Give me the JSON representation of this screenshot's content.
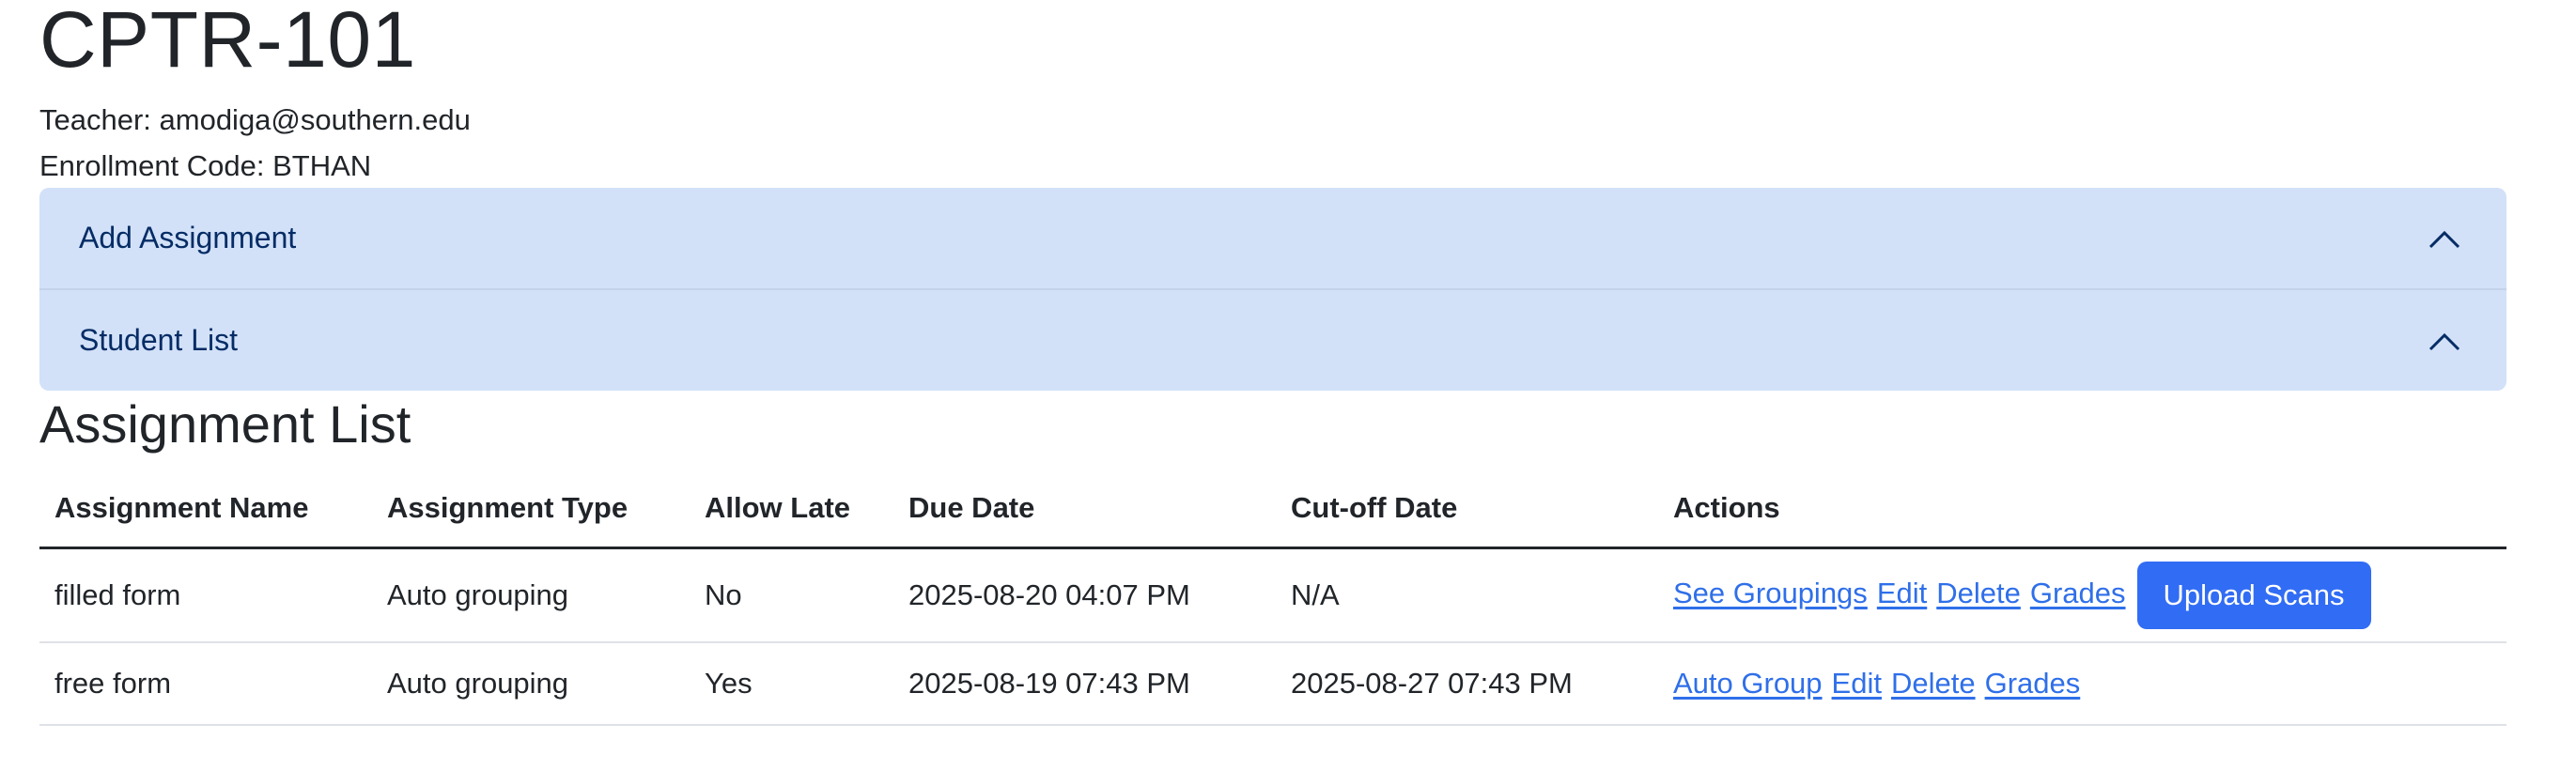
{
  "course": {
    "code": "CPTR-101",
    "teacher_line": "Teacher: amodiga@southern.edu",
    "enrollment_line": "Enrollment Code: BTHAN"
  },
  "accordion": [
    {
      "label": "Add Assignment",
      "icon": "chevron-up-icon"
    },
    {
      "label": "Student List",
      "icon": "chevron-up-icon"
    }
  ],
  "assignment_list": {
    "title": "Assignment List",
    "headers": [
      "Assignment Name",
      "Assignment Type",
      "Allow Late",
      "Due Date",
      "Cut-off Date",
      "Actions"
    ],
    "rows": [
      {
        "name": "filled form",
        "type": "Auto grouping",
        "allow_late": "No",
        "due_date": "2025-08-20 04:07 PM",
        "cutoff_date": "N/A",
        "actions": [
          "See Groupings",
          "Edit",
          "Delete",
          "Grades"
        ],
        "button": "Upload Scans"
      },
      {
        "name": "free form",
        "type": "Auto grouping",
        "allow_late": "Yes",
        "due_date": "2025-08-19 07:43 PM",
        "cutoff_date": "2025-08-27 07:43 PM",
        "actions": [
          "Auto Group",
          "Edit",
          "Delete",
          "Grades"
        ]
      }
    ]
  },
  "colors": {
    "accordion_bg": "#d2e1f8",
    "accordion_text": "#052c65",
    "link": "#2f6fe9",
    "primary_button": "#316cf4"
  }
}
